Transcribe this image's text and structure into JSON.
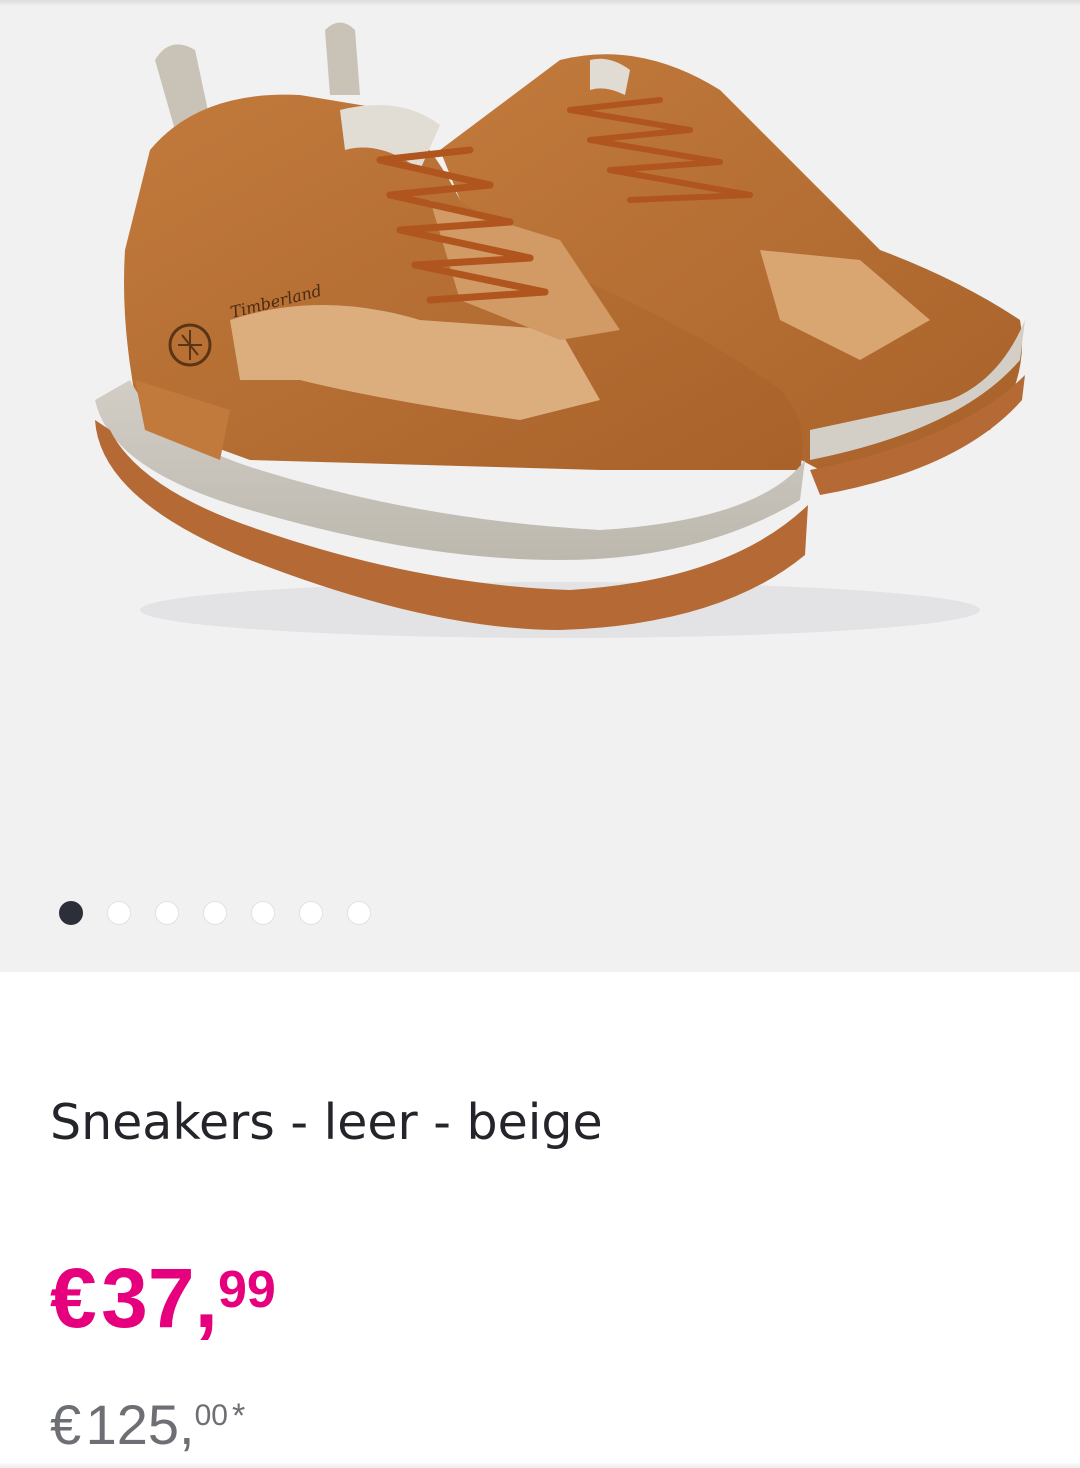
{
  "gallery": {
    "image_alt": "Timberland sneakers",
    "brand_text": "Timberland",
    "slide_count": 7,
    "active_slide": 1
  },
  "product": {
    "title": "Sneakers - leer - beige"
  },
  "price": {
    "current": {
      "currency": "€",
      "integer": "37,",
      "decimals": "99"
    },
    "original": {
      "currency": "€",
      "integer": "125,",
      "decimals": "00",
      "footnote": "*"
    }
  },
  "colors": {
    "sale_price": "#e6007e",
    "original_price": "#6d6f75",
    "title": "#23252b",
    "dot_active": "#2c2f3a",
    "gallery_background": "#f1f1f2"
  }
}
